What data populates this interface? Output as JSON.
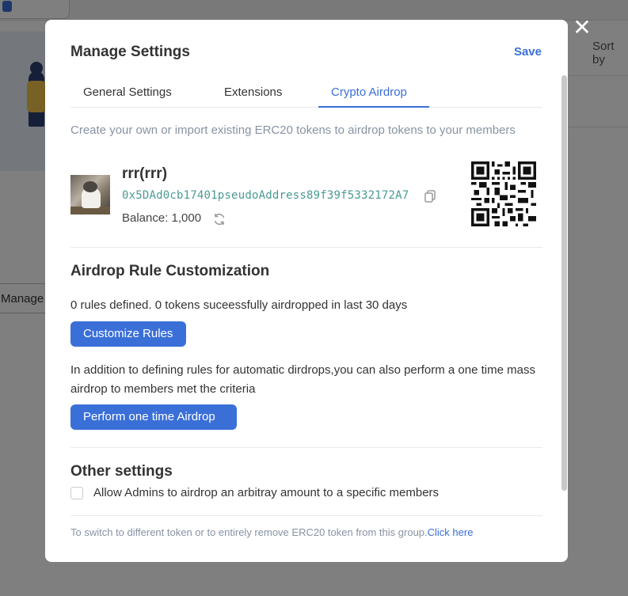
{
  "background": {
    "sort_label": "Sort by",
    "manage_label": "Manage"
  },
  "modal": {
    "title": "Manage Settings",
    "save_label": "Save",
    "close_icon": "close-icon",
    "tabs": [
      {
        "label": "General Settings",
        "active": false
      },
      {
        "label": "Extensions",
        "active": false
      },
      {
        "label": "Crypto Airdrop",
        "active": true
      }
    ],
    "intro": "Create your own or import existing ERC20 tokens to airdrop tokens to your members",
    "token": {
      "name": "rrr(rrr)",
      "address": "0x5DAd0cb17401pseudoAddress89f39f5332172A7",
      "balance": "Balance: 1,000"
    },
    "airdrop": {
      "title": "Airdrop Rule Customization",
      "rules_summary": "0 rules defined. 0 tokens suceessfully airdropped in last 30 days",
      "customize_label": "Customize Rules",
      "mass_text": "In addition to defining rules for automatic dirdrops,you can also perform a one time mass airdrop to members met the criteria",
      "perform_label": "Perform one time Airdrop"
    },
    "other": {
      "title": "Other settings",
      "allow_admins_label": "Allow Admins to airdrop an arbitray amount to a specific members",
      "allow_admins_checked": false
    },
    "footer": {
      "text": "To switch to different token or to entirely remove ERC20 token from this group.",
      "link": "Click here"
    }
  },
  "colors": {
    "accent": "#3a6fd8",
    "address": "#4a9b93",
    "muted": "#8893a3"
  }
}
